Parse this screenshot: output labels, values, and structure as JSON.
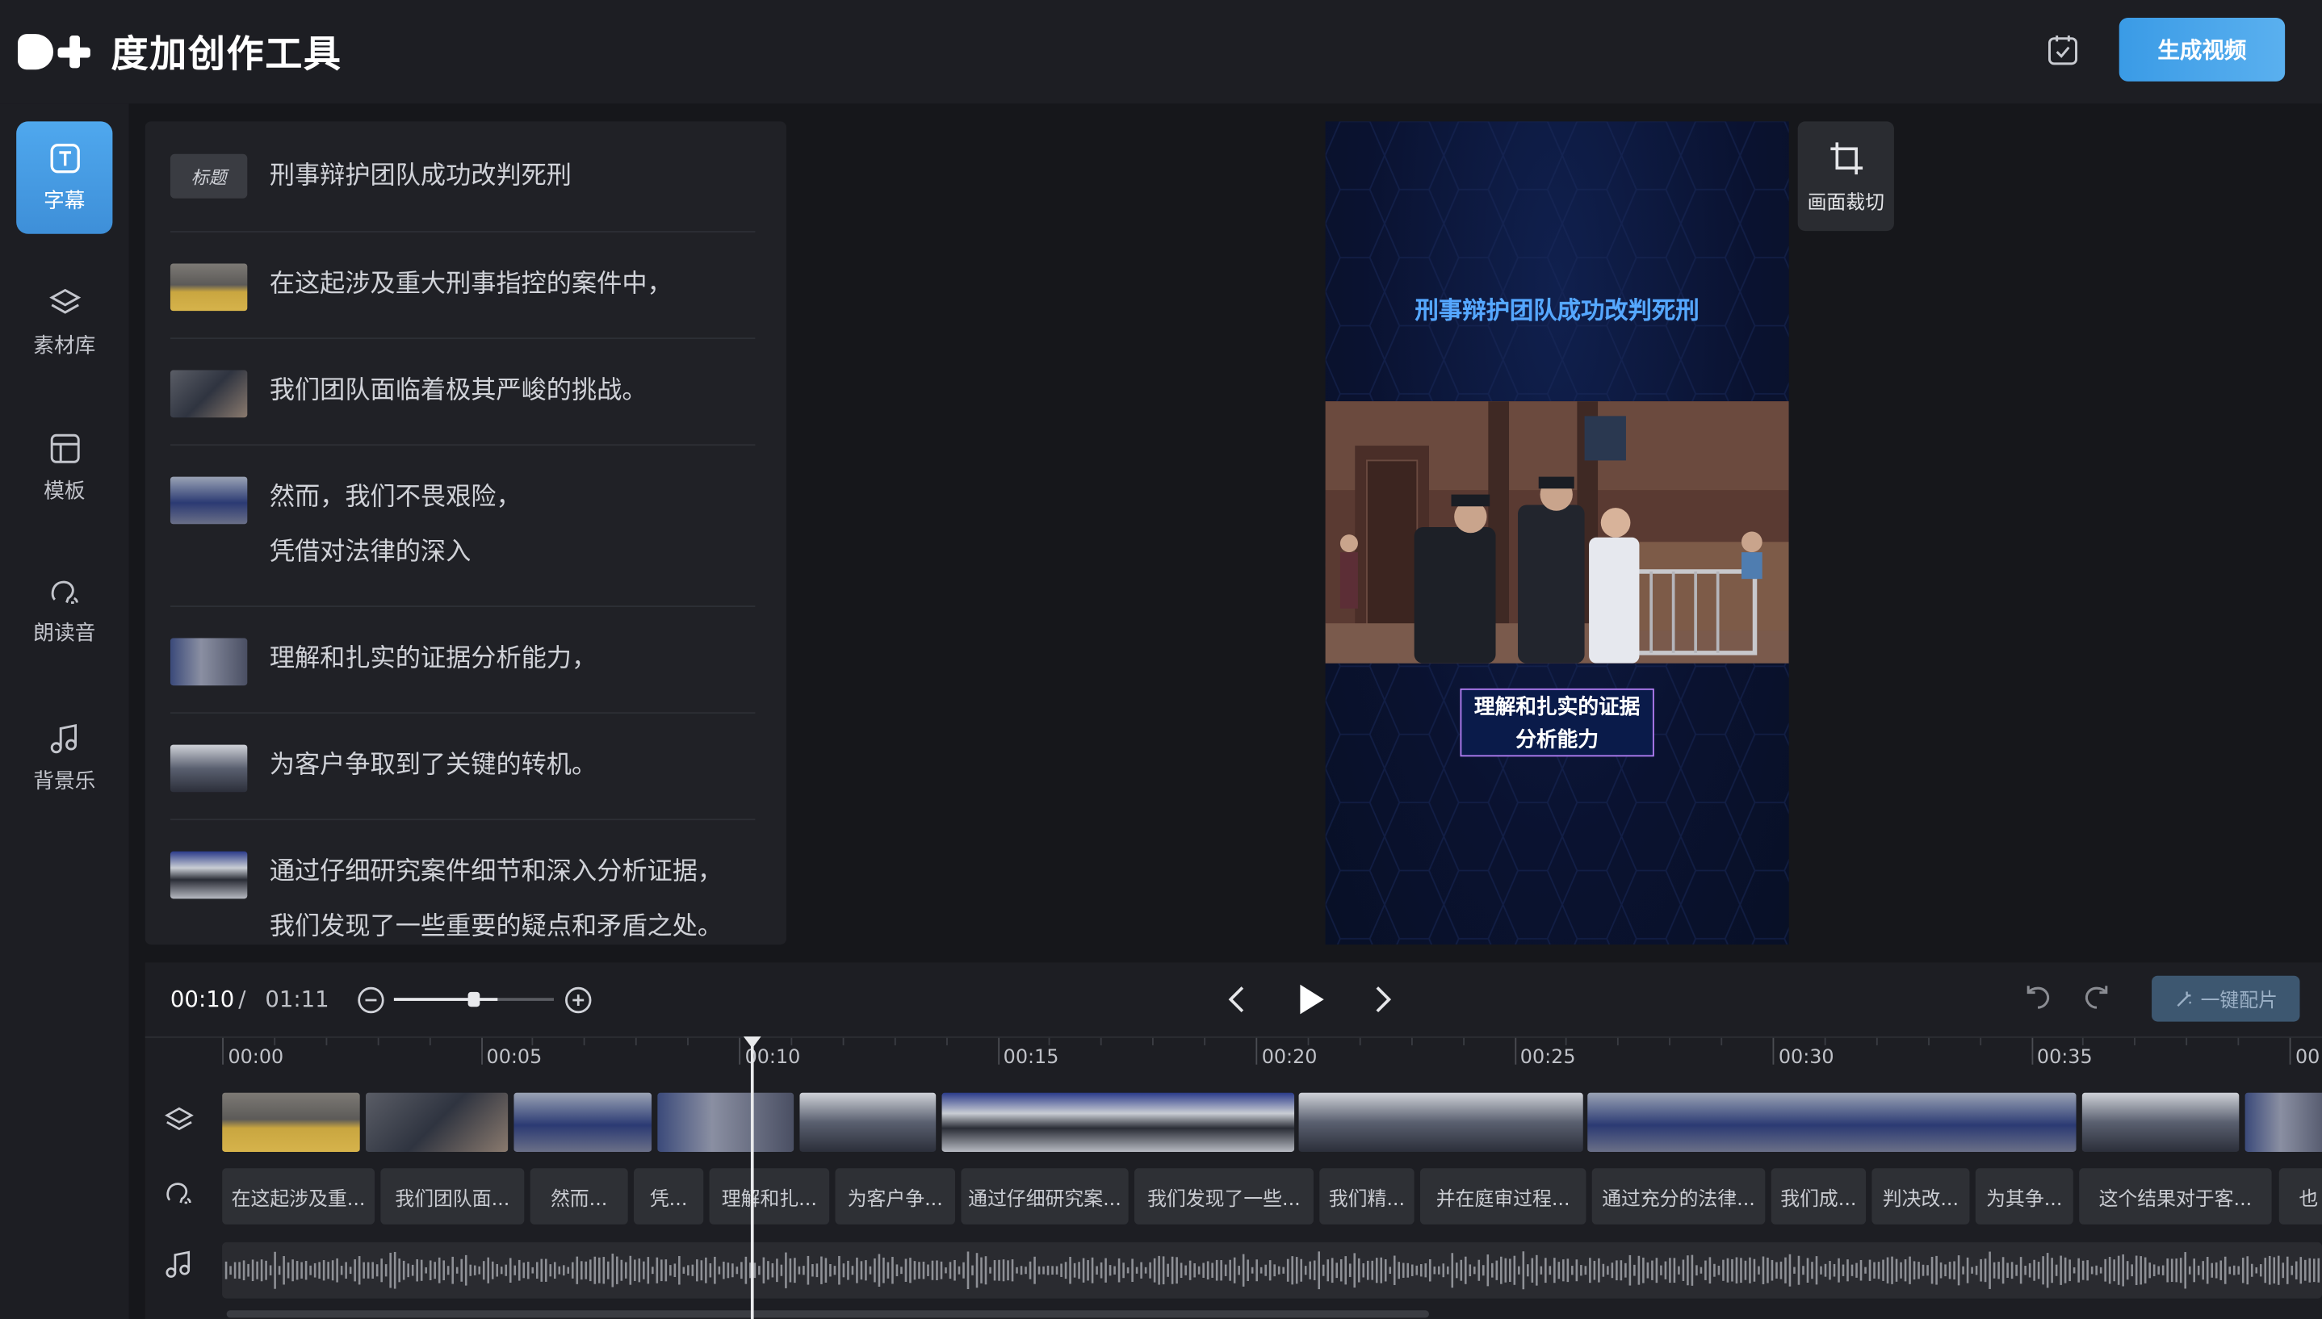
{
  "app": {
    "logo_text": "度加创作工具",
    "generate_label": "生成视频"
  },
  "colors": {
    "accent": "#4fa8ee",
    "background": "#16171b",
    "panel": "#202126",
    "preview_title": "#55a7ff",
    "caption_border": "#b47ef5"
  },
  "nav": {
    "items": [
      {
        "label": "字幕",
        "icon": "subtitle-icon",
        "active": true
      },
      {
        "label": "素材库",
        "icon": "layers-icon"
      },
      {
        "label": "模板",
        "icon": "template-icon"
      },
      {
        "label": "朗读音",
        "icon": "voice-icon"
      },
      {
        "label": "背景乐",
        "icon": "music-icon"
      }
    ]
  },
  "subtitle_list": {
    "title_badge": "标题",
    "title_text": "刑事辩护团队成功改判死刑",
    "rows": [
      {
        "lines": [
          "在这起涉及重大刑事指控的案件中，"
        ]
      },
      {
        "lines": [
          "我们团队面临着极其严峻的挑战。"
        ]
      },
      {
        "lines": [
          "然而，我们不畏艰险，",
          "凭借对法律的深入"
        ]
      },
      {
        "lines": [
          "理解和扎实的证据分析能力，"
        ]
      },
      {
        "lines": [
          "为客户争取到了关键的转机。"
        ]
      },
      {
        "lines": [
          "通过仔细研究案件细节和深入分析证据，",
          "我们发现了一些重要的疑点和矛盾之处。"
        ]
      }
    ]
  },
  "preview": {
    "title": "刑事辩护团队成功改判死刑",
    "caption_line1": "理解和扎实的证据",
    "caption_line2": "分析能力",
    "crop_label": "画面裁切"
  },
  "timeline": {
    "current_time": "00:10",
    "separator": "/",
    "total_time": "01:11",
    "zoom_level": 0.65,
    "auto_match_label": "一键配片",
    "ruler": [
      "00:00",
      "00:05",
      "00:10",
      "00:15",
      "00:20",
      "00:25",
      "00:30",
      "00:35",
      "00:"
    ],
    "text_clips": [
      "在这起涉及重...",
      "我们团队面...",
      "然而...",
      "凭...",
      "理解和扎...",
      "为客户争...",
      "通过仔细研究案...",
      "我们发现了一些...",
      "我们精...",
      "并在庭审过程...",
      "通过充分的法律...",
      "我们成...",
      "判决改...",
      "为其争...",
      "这个结果对于客...",
      "也"
    ]
  }
}
